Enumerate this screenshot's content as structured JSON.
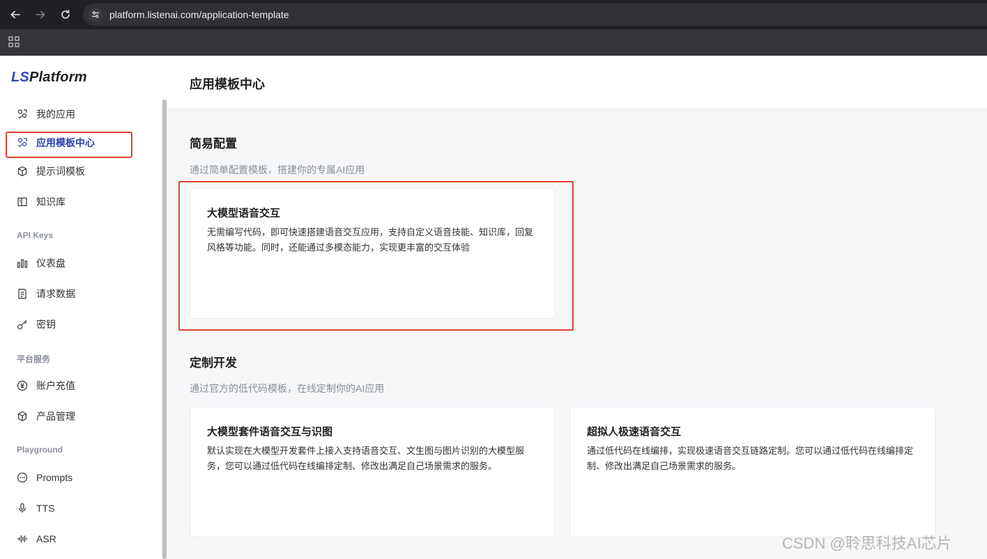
{
  "browser": {
    "url": "platform.listenai.com/application-template"
  },
  "sidebar": {
    "logo_prefix": "LS",
    "logo_suffix": "Platform",
    "items": [
      {
        "label": "我的应用",
        "icon": "apps-icon"
      },
      {
        "label": "应用模板中心",
        "icon": "apps-icon",
        "active": true
      },
      {
        "label": "提示词模板",
        "icon": "cube-icon"
      },
      {
        "label": "知识库",
        "icon": "book-icon"
      }
    ],
    "section_api": "API Keys",
    "api_items": [
      {
        "label": "仪表盘",
        "icon": "bar-chart-icon"
      },
      {
        "label": "请求数据",
        "icon": "document-icon"
      },
      {
        "label": "密钥",
        "icon": "key-icon"
      }
    ],
    "section_services": "平台服务",
    "service_items": [
      {
        "label": "账户充值",
        "icon": "yen-icon"
      },
      {
        "label": "产品管理",
        "icon": "cube-icon"
      }
    ],
    "section_playground": "Playground",
    "playground_items": [
      {
        "label": "Prompts",
        "icon": "chat-icon"
      },
      {
        "label": "TTS",
        "icon": "mic-icon"
      },
      {
        "label": "ASR",
        "icon": "waveform-icon"
      }
    ]
  },
  "main": {
    "page_title": "应用模板中心",
    "sections": [
      {
        "title": "简易配置",
        "desc": "通过简单配置模板，搭建你的专属AI应用",
        "cards": [
          {
            "title": "大模型语音交互",
            "desc": "无需编写代码，即可快速搭建语音交互应用，支持自定义语音技能、知识库，回复风格等功能。同时，还能通过多模态能力，实现更丰富的交互体验"
          }
        ]
      },
      {
        "title": "定制开发",
        "desc": "通过官方的低代码模板，在线定制你的AI应用",
        "cards": [
          {
            "title": "大模型套件语音交互与识图",
            "desc": "默认实现在大模型开发套件上接入支持语音交互、文生图与图片识别的大模型服务，您可以通过低代码在线编排定制、修改出满足自己场景需求的服务。"
          },
          {
            "title": "超拟人极速语音交互",
            "desc": "通过低代码在线编排，实现极速语音交互链路定制。您可以通过低代码在线编排定制、修改出满足自己场景需求的服务。"
          }
        ]
      }
    ]
  },
  "watermark": "CSDN @聆思科技AI芯片",
  "colors": {
    "accent": "#2a3fae",
    "highlight": "#e0412f",
    "browser_dark": "#202124"
  }
}
